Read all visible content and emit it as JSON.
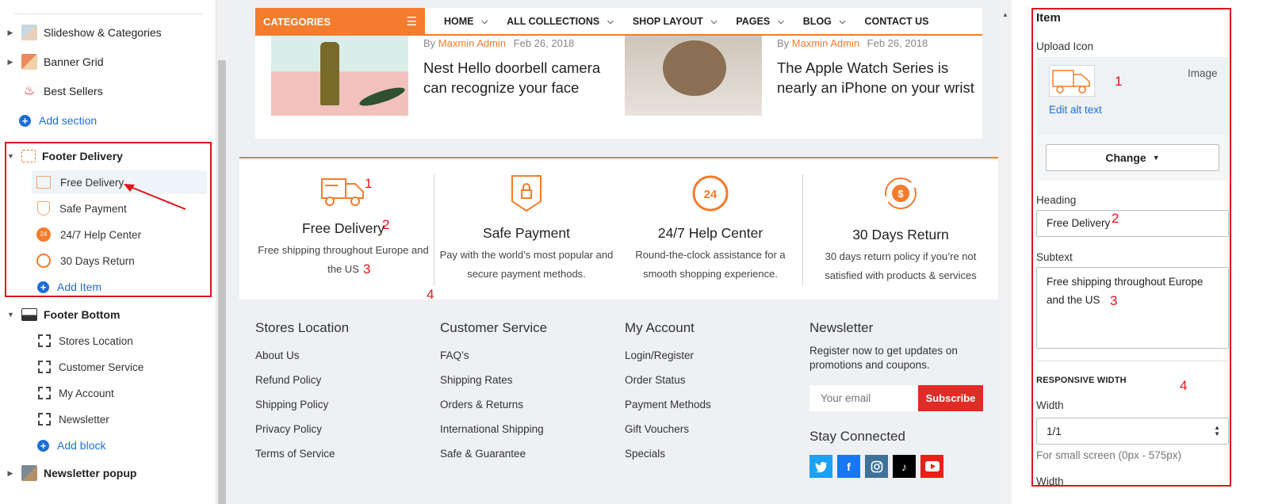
{
  "sidebar": {
    "sections": [
      {
        "label": "Slideshow & Categories"
      },
      {
        "label": "Banner Grid"
      },
      {
        "label": "Best Sellers"
      }
    ],
    "add_section": "Add section",
    "footer_delivery": {
      "label": "Footer Delivery",
      "items": [
        {
          "label": "Free Delivery"
        },
        {
          "label": "Safe Payment"
        },
        {
          "label": "24/7 Help Center"
        },
        {
          "label": "30 Days Return"
        }
      ],
      "add_item": "Add Item"
    },
    "footer_bottom": {
      "label": "Footer Bottom",
      "items": [
        {
          "label": "Stores Location"
        },
        {
          "label": "Customer Service"
        },
        {
          "label": "My Account"
        },
        {
          "label": "Newsletter"
        }
      ],
      "add_block": "Add block"
    },
    "newsletter_popup": "Newsletter popup"
  },
  "preview": {
    "nav": {
      "categories": "CATEGORIES",
      "items": [
        {
          "label": "HOME"
        },
        {
          "label": "ALL COLLECTIONS"
        },
        {
          "label": "SHOP LAYOUT"
        },
        {
          "label": "PAGES"
        },
        {
          "label": "BLOG"
        },
        {
          "label": "CONTACT US"
        }
      ]
    },
    "posts": [
      {
        "by": "By",
        "author": "Maxmin Admin",
        "date": "Feb 26, 2018",
        "title_line1": "Nest Hello doorbell camera",
        "title_line2": "can recognize your face"
      },
      {
        "by": "By",
        "author": "Maxmin Admin",
        "date": "Feb 26, 2018",
        "title_line1": "The Apple Watch Series is",
        "title_line2": "nearly an iPhone on your wrist"
      }
    ],
    "delivery": [
      {
        "heading": "Free Delivery",
        "line1": "Free shipping throughout Europe and",
        "line2": "the US"
      },
      {
        "heading": "Safe Payment",
        "line1": "Pay with the world’s most popular and",
        "line2": "secure payment methods."
      },
      {
        "heading": "24/7 Help Center",
        "line1": "Round-the-clock assistance for a",
        "line2": "smooth shopping experience."
      },
      {
        "heading": "30 Days Return",
        "line1": "30 days return policy if you’re not",
        "line2": "satisfied with products & services"
      }
    ],
    "footer": {
      "stores": {
        "heading": "Stores Location",
        "links": [
          "About Us",
          "Refund Policy",
          "Shipping Policy",
          "Privacy Policy",
          "Terms of Service"
        ]
      },
      "service": {
        "heading": "Customer Service",
        "links": [
          "FAQ’s",
          "Shipping Rates",
          "Orders & Returns",
          "International Shipping",
          "Safe & Guarantee"
        ]
      },
      "account": {
        "heading": "My Account",
        "links": [
          "Login/Register",
          "Order Status",
          "Payment Methods",
          "Gift Vouchers",
          "Specials"
        ]
      },
      "newsletter": {
        "heading": "Newsletter",
        "text_line1": "Register now to get updates on",
        "text_line2": "promotions and coupons.",
        "email_placeholder": "Your email",
        "subscribe": "Subscribe",
        "stay_connected": "Stay Connected",
        "socials": [
          {
            "icon": "twitter-icon",
            "color": "#1da1f2"
          },
          {
            "icon": "facebook-icon",
            "color": "#1877f2"
          },
          {
            "icon": "instagram-icon",
            "color": "#3f729b"
          },
          {
            "icon": "tiktok-icon",
            "color": "#000000"
          },
          {
            "icon": "youtube-icon",
            "color": "#e62117"
          }
        ]
      }
    }
  },
  "panel": {
    "title": "Item",
    "upload_icon_label": "Upload Icon",
    "image_word": "Image",
    "edit_alt": "Edit alt text",
    "change": "Change",
    "heading_label": "Heading",
    "heading_value": "Free Delivery",
    "subtext_label": "Subtext",
    "subtext_line1": "Free shipping throughout Europe",
    "subtext_line2": "and the US",
    "responsive_width": "RESPONSIVE WIDTH",
    "width_label": "Width",
    "width_value": "1/1",
    "hint": "For small screen (0px - 575px)",
    "width_label_2": "Width"
  },
  "annotations": {
    "n1": "1",
    "n2": "2",
    "n3": "3",
    "n4": "4"
  },
  "colors": {
    "accent": "#f37c2d",
    "annotation": "#e0141b",
    "link": "#1d6fd6"
  }
}
